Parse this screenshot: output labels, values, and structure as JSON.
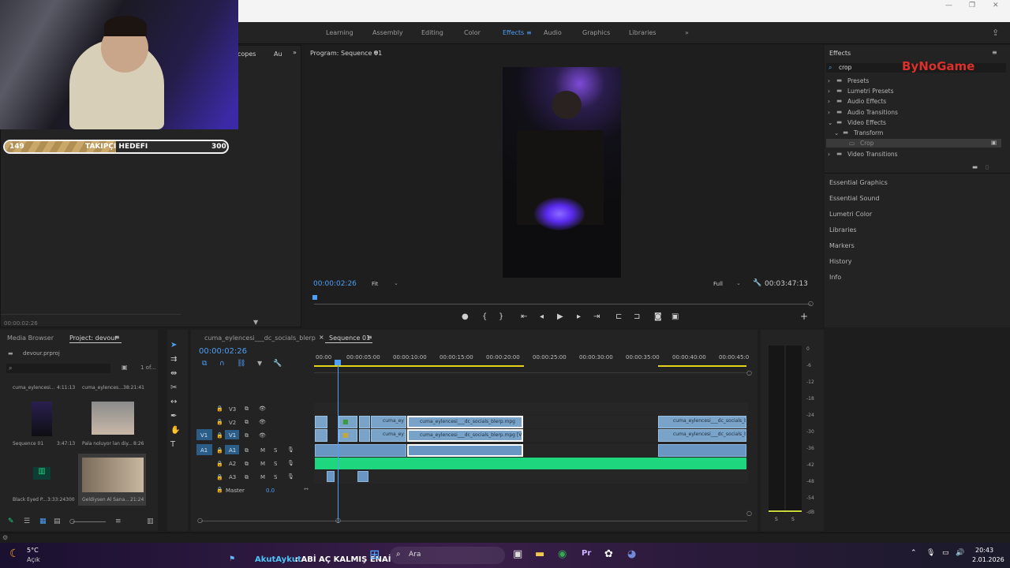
{
  "workspaces": [
    "Learning",
    "Assembly",
    "Editing",
    "Color",
    "Effects",
    "Audio",
    "Graphics",
    "Libraries"
  ],
  "active_workspace": "Effects",
  "stream": {
    "goal_current": "149",
    "goal_label": "TAKIPÇI HEDEFI",
    "goal_target": "300",
    "goal_progress": 0.5
  },
  "left_panel": {
    "tab1": "copes",
    "tab2": "Au",
    "timecode": "00:00:02:26"
  },
  "program": {
    "title": "Program: Sequence 01",
    "timecode": "00:00:02:26",
    "fit": "Fit",
    "quality": "Full",
    "duration": "00:03:47:13"
  },
  "effects": {
    "title": "Effects",
    "search": "crop",
    "tree": [
      "Presets",
      "Lumetri Presets",
      "Audio Effects",
      "Audio Transitions",
      "Video Effects",
      "Transform",
      "Crop",
      "Video Transitions"
    ],
    "sections": [
      "Essential Graphics",
      "Essential Sound",
      "Lumetri Color",
      "Libraries",
      "Markers",
      "History",
      "Info"
    ],
    "watermark": "ByNoGame"
  },
  "project": {
    "tab_media": "Media Browser",
    "tab_project": "Project: devour",
    "file": "devour.prproj",
    "count": "1 of...",
    "items": [
      {
        "name": "cuma_eylencesi...",
        "dur": "4:11:13"
      },
      {
        "name": "cuma_eylences...",
        "dur": "38:21:41"
      },
      {
        "name": "Sequence 01",
        "dur": "3:47:13"
      },
      {
        "name": "Pala noluyor lan diy...",
        "dur": "8:26"
      },
      {
        "name": "Black Eyed P...",
        "dur": "3:33:24300"
      },
      {
        "name": "Geldiysen Al Sana...",
        "dur": "21:24"
      }
    ]
  },
  "timeline": {
    "tab_other": "cuma_eylencesi___dc_socials_blerp",
    "tab_seq": "Sequence 01",
    "timecode": "00:00:02:26",
    "ruler": [
      "00:00",
      "00:00:05:00",
      "00:00:10:00",
      "00:00:15:00",
      "00:00:20:00",
      "00:00:25:00",
      "00:00:30:00",
      "00:00:35:00",
      "00:00:40:00",
      "00:00:45:0"
    ],
    "tracks": [
      "V3",
      "V2",
      "V1",
      "A1",
      "A2",
      "A3"
    ],
    "src_v": "V1",
    "src_a": "A1",
    "master": "Master",
    "master_val": "0.0",
    "clip_short": "cuma_ey",
    "clip1": "cuma_eylencesi___dc_socials_blerp.mpg",
    "clip2": "cuma_eylencesi___dc_socials_blerp.mpg [V]",
    "clip3": "cuma_eylencesi___dc_socials_bl",
    "clip4": "cuma_eylencesi___dc_socials_bl"
  },
  "meters": {
    "db": [
      "0",
      "-6",
      "-12",
      "-18",
      "-24",
      "-30",
      "-36",
      "-42",
      "-48",
      "-54",
      "-dB"
    ],
    "s1": "S",
    "s2": "S"
  },
  "taskbar": {
    "temp": "5°C",
    "weather": "Açık",
    "ticker_name": "AkutAykut",
    "ticker_text": ": ABİ AÇ KALMIŞ ENAİ",
    "search": "Ara",
    "time": "20:43",
    "date": "2.01.2026"
  }
}
